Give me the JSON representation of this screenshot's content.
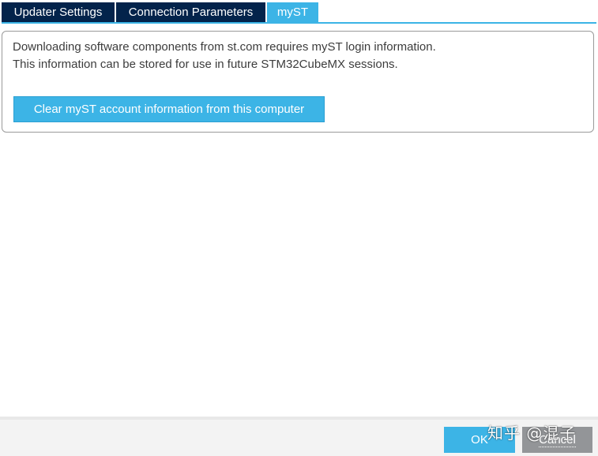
{
  "tabs": [
    {
      "label": "Updater Settings",
      "active": false
    },
    {
      "label": "Connection Parameters",
      "active": false
    },
    {
      "label": "myST",
      "active": true
    }
  ],
  "myst_panel": {
    "info_line_1": "Downloading software components from st.com requires myST login information.",
    "info_line_2": "This information can be stored for use in future STM32CubeMX sessions.",
    "clear_button_label": "Clear myST account information from this computer"
  },
  "dialog_buttons": {
    "ok_label": "OK",
    "cancel_label": "Cancel"
  },
  "watermark": "知乎 @混子",
  "colors": {
    "tab_dark": "#03234b",
    "accent": "#3cb4e6",
    "cancel_gray": "#939598",
    "text": "#3c3c3c"
  }
}
